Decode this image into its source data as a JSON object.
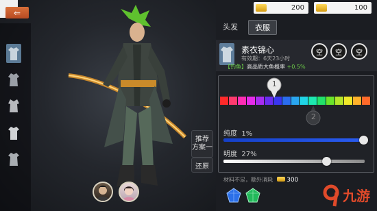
{
  "scene": {
    "back_icon": "back-arrow-icon",
    "sidebar_items": [
      "outfit-1",
      "outfit-2",
      "outfit-3",
      "outfit-4",
      "outfit-5"
    ],
    "recommend_label_1": "推荐",
    "recommend_label_2": "方案一",
    "restore_label": "还原"
  },
  "currency": [
    {
      "icon": "gold-ingot-icon",
      "value": "200"
    },
    {
      "icon": "gold-ingot-icon",
      "value": "100"
    }
  ],
  "tabs": [
    {
      "label": "头发",
      "active": false
    },
    {
      "label": "衣服",
      "active": true
    }
  ],
  "item": {
    "name": "素衣锦心",
    "validity": "有效期：6天23小时",
    "bonus_tag": "【钓鱼】",
    "bonus_text": "高品质大鱼概率",
    "bonus_value": "+0.5%",
    "slots": [
      "空",
      "空",
      "空"
    ]
  },
  "color": {
    "marker1": "1",
    "marker2": "2",
    "palette": [
      "#ff2a2a",
      "#ff3a6e",
      "#ff2db4",
      "#e62bea",
      "#a82cf0",
      "#6a2cf0",
      "#3a36f0",
      "#2a6df0",
      "#2aa6f0",
      "#20d4e6",
      "#1de8b0",
      "#22e26a",
      "#6be42a",
      "#b5e62a",
      "#f0e82a",
      "#ffb12a",
      "#ff6a2a"
    ],
    "marker1_fraction": 0.36,
    "marker2_fraction": 0.62,
    "purity_label": "纯度",
    "purity_value": "1%",
    "purity_level": 0.99,
    "brightness_label": "明度",
    "brightness_value": "27%",
    "brightness_level": 0.73
  },
  "footer": {
    "shortage_text": "材料不足，额外消耗",
    "cost_value": "300"
  },
  "watermark": "9九游"
}
